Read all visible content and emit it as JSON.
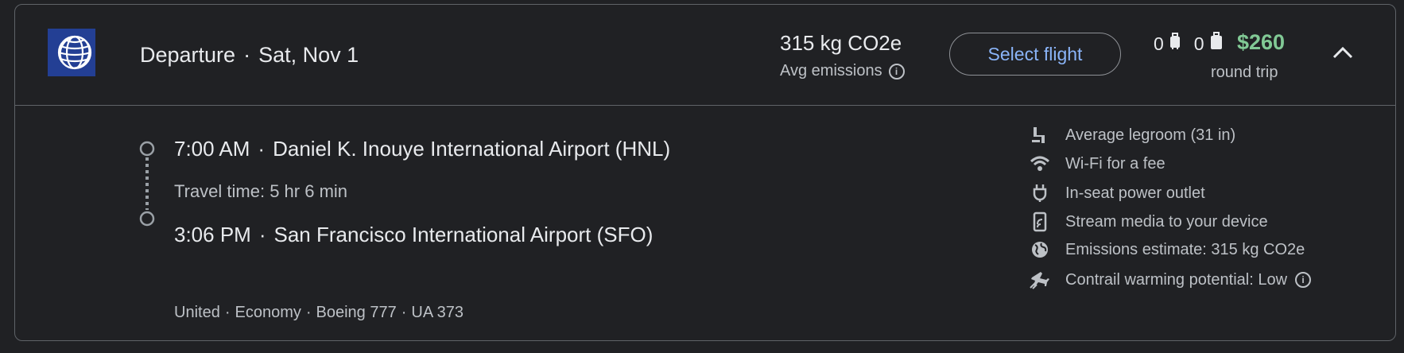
{
  "header": {
    "direction": "Departure",
    "date": "Sat, Nov 1",
    "emissions_value": "315 kg CO2e",
    "emissions_label": "Avg emissions",
    "select_label": "Select flight",
    "carry_on_count": "0",
    "checked_count": "0",
    "price": "$260",
    "trip_type": "round trip"
  },
  "segment": {
    "depart_time": "7:00 AM",
    "depart_airport": "Daniel K. Inouye International Airport (HNL)",
    "travel_time": "Travel time: 5 hr 6 min",
    "arrive_time": "3:06 PM",
    "arrive_airport": "San Francisco International Airport (SFO)",
    "airline": "United",
    "cabin": "Economy",
    "aircraft": "Boeing 777",
    "flight_number": "UA 373"
  },
  "amenities": [
    {
      "icon": "legroom-icon",
      "label": "Average legroom (31 in)"
    },
    {
      "icon": "wifi-icon",
      "label": "Wi-Fi for a fee"
    },
    {
      "icon": "power-outlet-icon",
      "label": "In-seat power outlet"
    },
    {
      "icon": "stream-media-icon",
      "label": "Stream media to your device"
    },
    {
      "icon": "globe-icon",
      "label": "Emissions estimate: 315 kg CO2e"
    },
    {
      "icon": "contrail-icon",
      "label": "Contrail warming potential: Low"
    }
  ],
  "colors": {
    "background": "#202124",
    "border": "#5f6368",
    "accent": "#8ab4f8",
    "price": "#81c995",
    "logo_bg": "#233f94"
  }
}
